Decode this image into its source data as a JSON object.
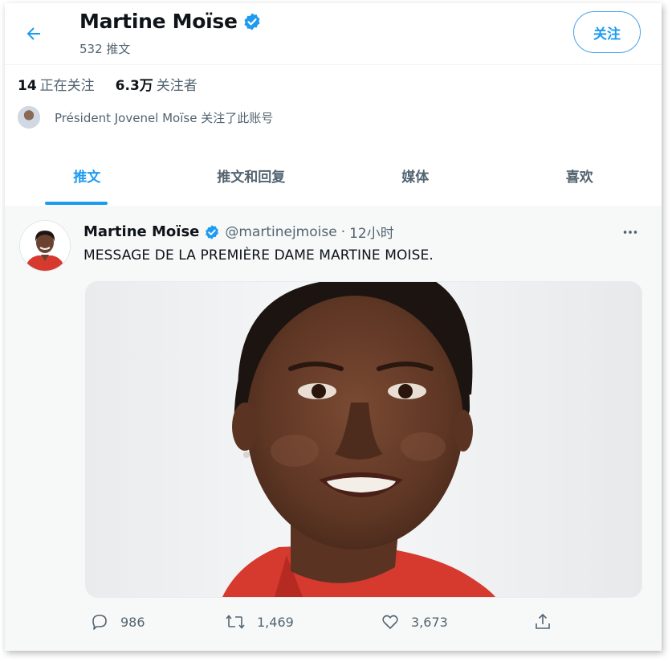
{
  "profile": {
    "name": "Martine Moïse",
    "tweet_count": "532 推文",
    "follow_label": "关注",
    "following_count": "14",
    "following_label": "正在关注",
    "followers_count": "6.3万",
    "followers_label": "关注者",
    "followed_by": "Président Jovenel Moïse 关注了此账号"
  },
  "tabs": [
    {
      "label": "推文",
      "active": true
    },
    {
      "label": "推文和回复",
      "active": false
    },
    {
      "label": "媒体",
      "active": false
    },
    {
      "label": "喜欢",
      "active": false
    }
  ],
  "tweet": {
    "author": "Martine Moïse",
    "handle": "@martinejmoise",
    "separator": "·",
    "time": "12小时",
    "text": "MESSAGE DE LA PREMIÈRE DAME MARTINE MOISE.",
    "replies": "986",
    "retweets": "1,469",
    "likes": "3,673"
  },
  "colors": {
    "accent": "#1d9bf0",
    "secondary_text": "#536471",
    "shirt": "#d63a2f"
  },
  "icons": [
    "back-arrow-icon",
    "verified-badge-icon",
    "more-icon",
    "reply-icon",
    "retweet-icon",
    "like-icon",
    "share-icon"
  ]
}
